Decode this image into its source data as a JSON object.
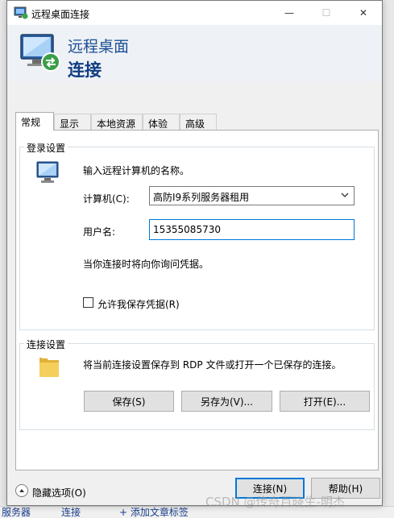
{
  "window": {
    "title": "远程桌面连接",
    "min_symbol": "—",
    "max_symbol": "☐",
    "close_symbol": "✕"
  },
  "header": {
    "line1": "远程桌面",
    "line2": "连接"
  },
  "tabs": [
    {
      "label": "常规",
      "active": true
    },
    {
      "label": "显示",
      "active": false
    },
    {
      "label": "本地资源",
      "active": false
    },
    {
      "label": "体验",
      "active": false
    },
    {
      "label": "高级",
      "active": false
    }
  ],
  "login": {
    "group_label": "登录设置",
    "instruction": "输入远程计算机的名称。",
    "computer_label": "计算机(C):",
    "computer_value": "高防I9系列服务器租用",
    "username_label": "用户名:",
    "username_value": "15355085730",
    "ask_credentials": "当你连接时将向你询问凭据。",
    "save_credentials_label": "允许我保存凭据(R)",
    "save_credentials_checked": false
  },
  "connection": {
    "group_label": "连接设置",
    "description": "将当前连接设置保存到 RDP 文件或打开一个已保存的连接。",
    "save_button": "保存(S)",
    "save_as_button": "另存为(V)...",
    "open_button": "打开(E)..."
  },
  "footer": {
    "hide_options": "隐藏选项(O)",
    "connect_button": "连接(N)",
    "help_button": "帮助(H)"
  },
  "background": {
    "tab1": "服务器",
    "tab2": "连接",
    "tab3": "+ 添加文章标签"
  },
  "watermark": "CSDN @传奇百晓生-明杰",
  "colors": {
    "header_title": "#1b4f95",
    "focus_border": "#0078d7"
  }
}
